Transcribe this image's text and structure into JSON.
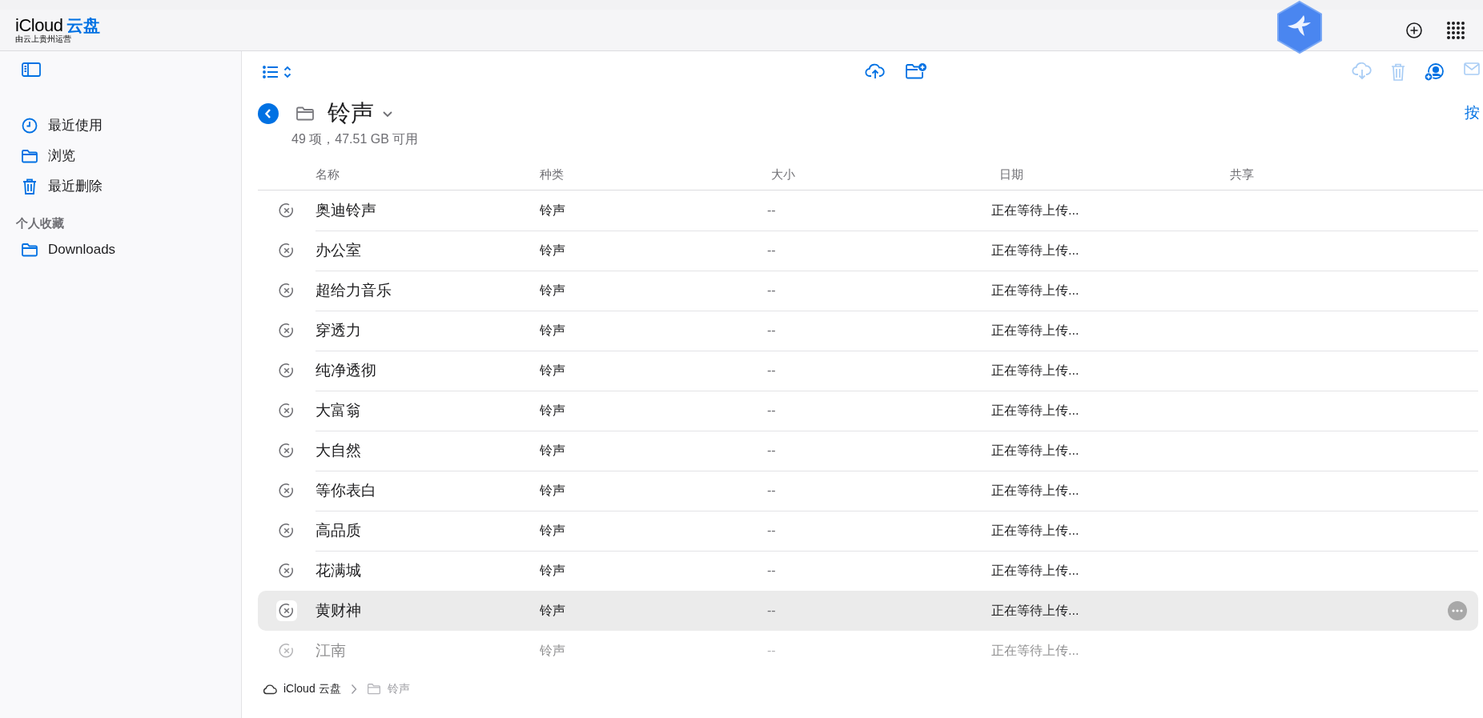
{
  "header": {
    "logo": "iCloud",
    "logo_accent": "云盘",
    "subtitle": "由云上贵州运营"
  },
  "sidebar": {
    "items": [
      {
        "label": "最近使用",
        "selected": false
      },
      {
        "label": "浏览",
        "selected": false
      },
      {
        "label": "最近删除",
        "selected": false
      }
    ],
    "section_title": "个人收藏",
    "favorites": [
      {
        "label": "Downloads",
        "selected": false
      }
    ]
  },
  "folder": {
    "title": "铃声",
    "info": "49 项，47.51 GB 可用",
    "right_text": "按"
  },
  "table": {
    "columns": [
      "名称",
      "种类",
      "大小",
      "日期",
      "共享"
    ],
    "rows": [
      {
        "name": "奥迪铃声",
        "kind": "铃声",
        "size": "--",
        "date": "正在等待上传...",
        "selected": false,
        "dimmed": false
      },
      {
        "name": "办公室",
        "kind": "铃声",
        "size": "--",
        "date": "正在等待上传...",
        "selected": false,
        "dimmed": false
      },
      {
        "name": "超给力音乐",
        "kind": "铃声",
        "size": "--",
        "date": "正在等待上传...",
        "selected": false,
        "dimmed": false
      },
      {
        "name": "穿透力",
        "kind": "铃声",
        "size": "--",
        "date": "正在等待上传...",
        "selected": false,
        "dimmed": false
      },
      {
        "name": "纯净透彻",
        "kind": "铃声",
        "size": "--",
        "date": "正在等待上传...",
        "selected": false,
        "dimmed": false
      },
      {
        "name": "大富翁",
        "kind": "铃声",
        "size": "--",
        "date": "正在等待上传...",
        "selected": false,
        "dimmed": false
      },
      {
        "name": "大自然",
        "kind": "铃声",
        "size": "--",
        "date": "正在等待上传...",
        "selected": false,
        "dimmed": false
      },
      {
        "name": "等你表白",
        "kind": "铃声",
        "size": "--",
        "date": "正在等待上传...",
        "selected": false,
        "dimmed": false
      },
      {
        "name": "高品质",
        "kind": "铃声",
        "size": "--",
        "date": "正在等待上传...",
        "selected": false,
        "dimmed": false
      },
      {
        "name": "花满城",
        "kind": "铃声",
        "size": "--",
        "date": "正在等待上传...",
        "selected": false,
        "dimmed": false
      },
      {
        "name": "黄财神",
        "kind": "铃声",
        "size": "--",
        "date": "正在等待上传...",
        "selected": true,
        "dimmed": false
      },
      {
        "name": "江南",
        "kind": "铃声",
        "size": "--",
        "date": "正在等待上传...",
        "selected": false,
        "dimmed": true
      }
    ]
  },
  "breadcrumb": [
    {
      "label": "iCloud 云盘",
      "current": false
    },
    {
      "label": "铃声",
      "current": true
    }
  ]
}
